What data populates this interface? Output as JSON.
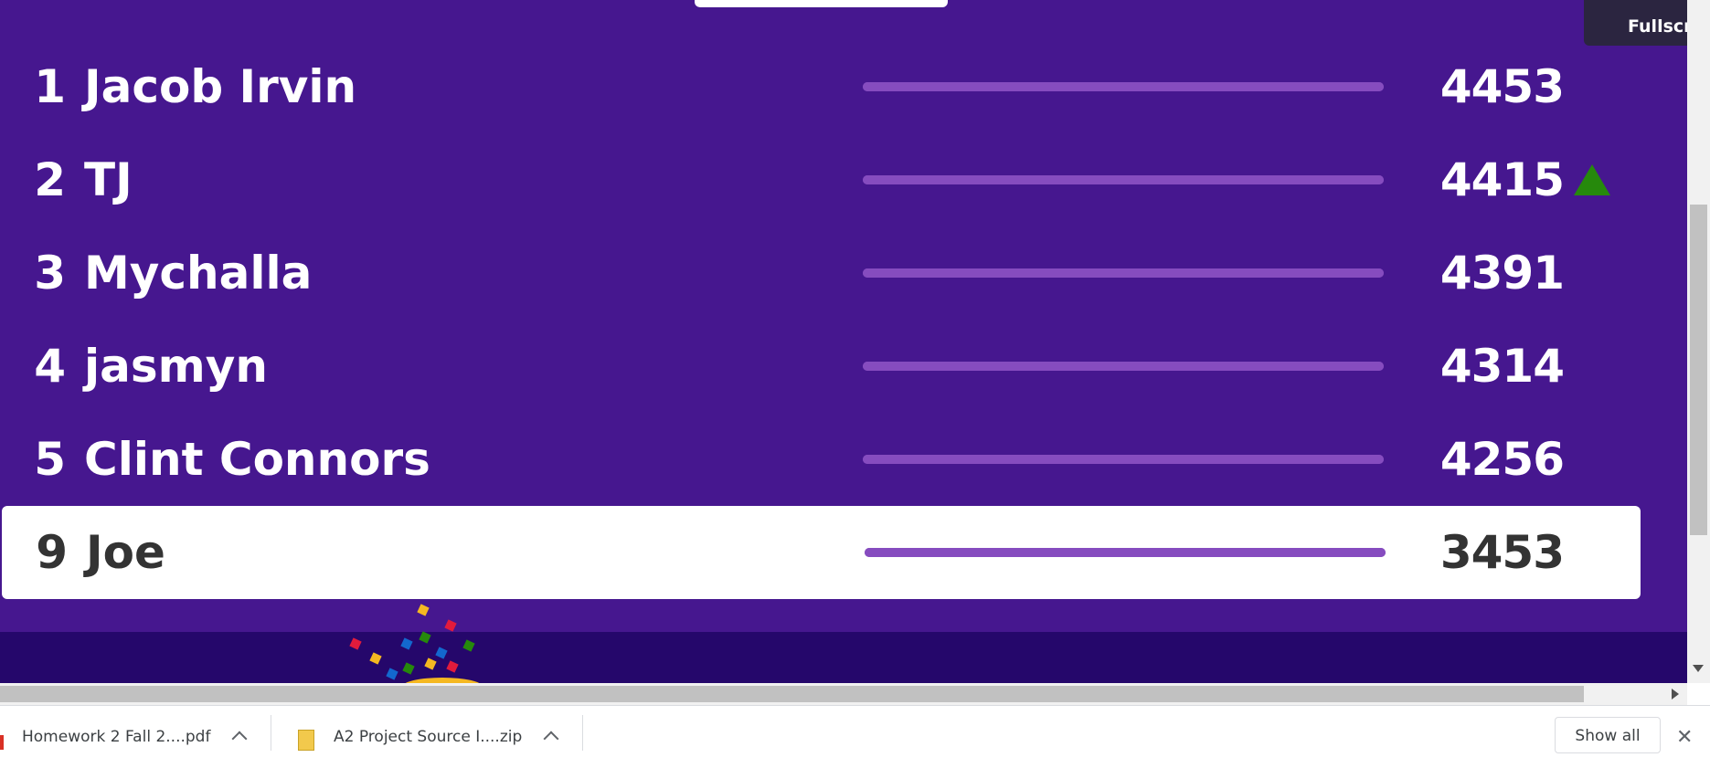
{
  "colors": {
    "background": "#46178f",
    "footer": "#25076b",
    "bar": "#864cbf",
    "highlight_row": "#ffffff",
    "rank_up": "#26890c"
  },
  "fullscreen_button": {
    "label": "Fullscr"
  },
  "leaderboard": {
    "rows": [
      {
        "rank": "1",
        "name": "Jacob Irvin",
        "score": "4453",
        "progress": 1.0,
        "trend": ""
      },
      {
        "rank": "2",
        "name": "TJ",
        "score": "4415",
        "progress": 1.0,
        "trend": "up-arrow-icon"
      },
      {
        "rank": "3",
        "name": "Mychalla",
        "score": "4391",
        "progress": 1.0,
        "trend": ""
      },
      {
        "rank": "4",
        "name": "jasmyn",
        "score": "4314",
        "progress": 1.0,
        "trend": ""
      },
      {
        "rank": "5",
        "name": "Clint Connors",
        "score": "4256",
        "progress": 1.0,
        "trend": ""
      }
    ],
    "current_player": {
      "rank": "9",
      "name": "Joe",
      "score": "3453",
      "progress": 1.0
    }
  },
  "downloads_bar": {
    "items": [
      {
        "filename": "Homework 2 Fall 2....pdf",
        "icon": "pdf-file-icon"
      },
      {
        "filename": "A2 Project Source I....zip",
        "icon": "zip-file-icon"
      }
    ],
    "show_all_label": "Show all",
    "close_icon": "✕"
  }
}
